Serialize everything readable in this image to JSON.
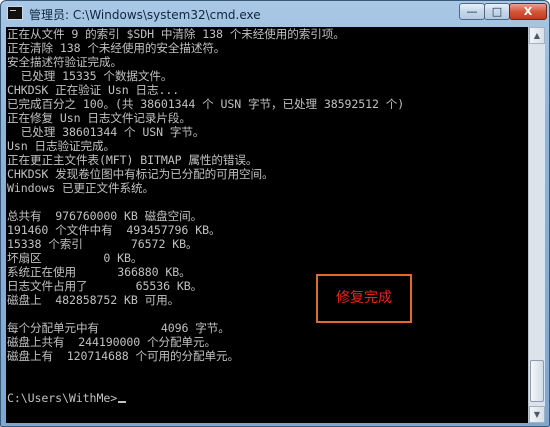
{
  "window": {
    "title": "管理员: C:\\Windows\\system32\\cmd.exe",
    "controls": {
      "minimize": "—",
      "maximize": "□",
      "close": "X"
    }
  },
  "console": {
    "lines": [
      "正在从文件 9 的索引 $SDH 中清除 138 个未经使用的索引项。",
      "正在清除 138 个未经使用的安全描述符。",
      "安全描述符验证完成。",
      "  已处理 15335 个数据文件。",
      "CHKDSK 正在验证 Usn 日志...",
      "已完成百分之 100。(共 38601344 个 USN 字节，已处理 38592512 个)",
      "正在修复 Usn 日志文件记录片段。",
      "  已处理 38601344 个 USN 字节。",
      "Usn 日志验证完成。",
      "正在更正主文件表(MFT) BITMAP 属性的错误。",
      "CHKDSK 发现卷位图中有标记为已分配的可用空间。",
      "Windows 已更正文件系统。",
      "",
      "总共有  976760000 KB 磁盘空间。",
      "191460 个文件中有  493457796 KB。",
      "15338 个索引       76572 KB。",
      "坏扇区         0 KB。",
      "系统正在使用      366880 KB。",
      "日志文件占用了       65536 KB。",
      "磁盘上  482858752 KB 可用。",
      "",
      "每个分配单元中有         4096 字节。",
      "磁盘上共有  244190000 个分配单元。",
      "磁盘上有  120714688 个可用的分配单元。",
      "",
      "C:\\Users\\WithMe>"
    ]
  },
  "annotation": {
    "text": "修复完成",
    "color": "#e8251a"
  },
  "scrollbar": {
    "up_glyph": "▲",
    "down_glyph": "▼"
  }
}
